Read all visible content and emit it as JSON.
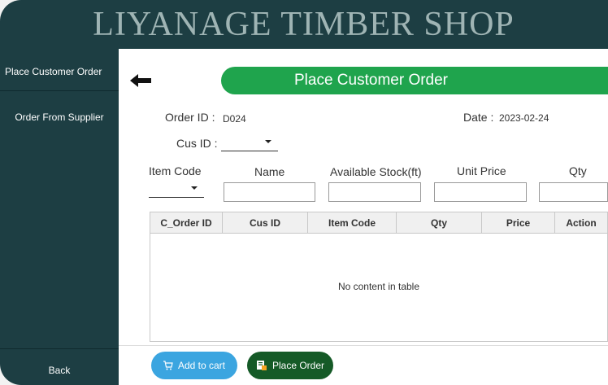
{
  "app": {
    "title": "LIYANAGE TIMBER SHOP"
  },
  "sidebar": {
    "items": [
      {
        "label": "Place Customer Order"
      },
      {
        "label": "Order From Supplier"
      }
    ],
    "back_label": "Back"
  },
  "page": {
    "banner": "Place Customer Order",
    "order_id_label": "Order ID :",
    "order_id_value": "D024",
    "date_label": "Date :",
    "date_value": "2023-02-24",
    "cus_id_label": "Cus ID :"
  },
  "item_fields": {
    "item_code_label": "Item Code",
    "name_label": "Name",
    "stock_label": "Available Stock(ft)",
    "unit_price_label": "Unit Price",
    "qty_label": "Qty"
  },
  "table": {
    "columns": [
      "C_Order ID",
      "Cus ID",
      "Item Code",
      "Qty",
      "Price",
      "Action"
    ],
    "empty_message": "No content in table"
  },
  "buttons": {
    "add_to_cart": "Add to cart",
    "place_order": "Place Order"
  },
  "colors": {
    "sidebar_bg": "#1d3e43",
    "banner_green": "#1fa44d",
    "cart_blue": "#3ba5e0",
    "order_green": "#155a27"
  },
  "icons": {
    "back": "arrow-left-icon",
    "cart": "cart-icon",
    "order": "order-icon"
  }
}
